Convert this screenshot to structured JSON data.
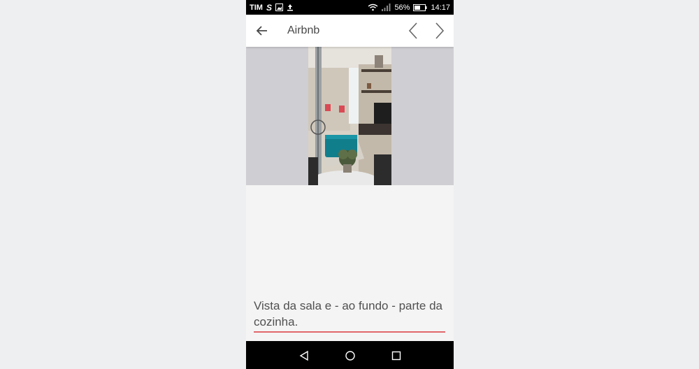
{
  "status_bar": {
    "carrier": "TIM",
    "battery_percent": "56%",
    "time": "14:17",
    "icons": [
      "s-app-icon",
      "image-icon",
      "upload-icon",
      "wifi-icon",
      "signal-icon",
      "battery-icon"
    ]
  },
  "app_bar": {
    "title": "Airbnb",
    "back_icon": "arrow-left-icon",
    "prev_icon": "chevron-left-icon",
    "next_icon": "chevron-right-icon"
  },
  "photo": {
    "description_icon": "listing-photo"
  },
  "caption": {
    "text": "Vista da sala e - ao fundo - parte da cozinha.",
    "accent_color": "#e2676a"
  },
  "nav_bar": {
    "icons": [
      "nav-back-icon",
      "nav-home-icon",
      "nav-recent-icon"
    ]
  },
  "colors": {
    "background": "#eeeff0",
    "status_bar": "#000000",
    "app_bar": "#ffffff",
    "photo_backdrop": "#cfced2",
    "content": "#f4f4f4"
  }
}
